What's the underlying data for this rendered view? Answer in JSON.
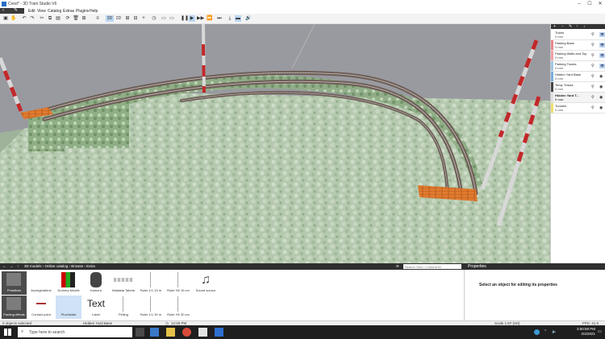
{
  "window": {
    "title": "Crest* - 3D Train Studio V6",
    "minimize_icon": "minimize-icon",
    "maximize_icon": "maximize-icon",
    "close_icon": "close-icon"
  },
  "menu": {
    "items": [
      "Edit",
      "View",
      "Catalog",
      "Extras",
      "Plugins",
      "Help"
    ]
  },
  "toolbar": {
    "view_3d_label": "3D",
    "view_2d_label": "2D"
  },
  "layers": {
    "items": [
      {
        "name": "Trains",
        "sub": "0 mm",
        "color": "#ffffff"
      },
      {
        "name": "Parking Base",
        "sub": "0 mm",
        "color": "#e8848a"
      },
      {
        "name": "Parking Walls and Top",
        "sub": "0 mm",
        "color": "#f2a0a6"
      },
      {
        "name": "Parking Tracks",
        "sub": "0 mm",
        "color": "#a0c8e8"
      },
      {
        "name": "Hidden Yard Base",
        "sub": "0 mm",
        "color": "#7aaedc"
      },
      {
        "name": "Temp Tracks",
        "sub": "0 mm",
        "color": "#444444"
      },
      {
        "name": "Hidden Yard T...",
        "sub": "0 mm",
        "color": "#e0e0e0"
      },
      {
        "name": "Tunnels",
        "sub": "0 mm",
        "color": "#f0e070"
      }
    ]
  },
  "catalog": {
    "breadcrumb": "3D models  ›  Online catalog  ›  Browse  ›  Extra",
    "search_placeholder": "Search Term / Content ID",
    "side_buttons": [
      "Primitives",
      "Parking effects"
    ],
    "row1": [
      "Anzeigetafene",
      "Dummy-Modell",
      "Kamera",
      "Mallasta Tabela",
      "Ruler 1/1 15 m",
      "Ruler H0 15 cm",
      "Sound source"
    ],
    "row2": [
      "Contact point",
      "Pluchtstab",
      "Label",
      "Pelling",
      "Ruler 1/1 30 m",
      "Ruler H0 30 cm"
    ],
    "text_thumb": "Text"
  },
  "properties": {
    "header": "Properties",
    "empty_message": "Select an object for editing its properties"
  },
  "status": {
    "selection": "0 objects selected",
    "layer": "Hidden Yard Base",
    "time": "12:00 PM",
    "scale": "Scale 1:87 (H0)",
    "fps": "FPS: 41.9"
  },
  "taskbar": {
    "search_placeholder": "Type here to search",
    "time": "3:50:59 PM",
    "date": "2/4/2021"
  }
}
